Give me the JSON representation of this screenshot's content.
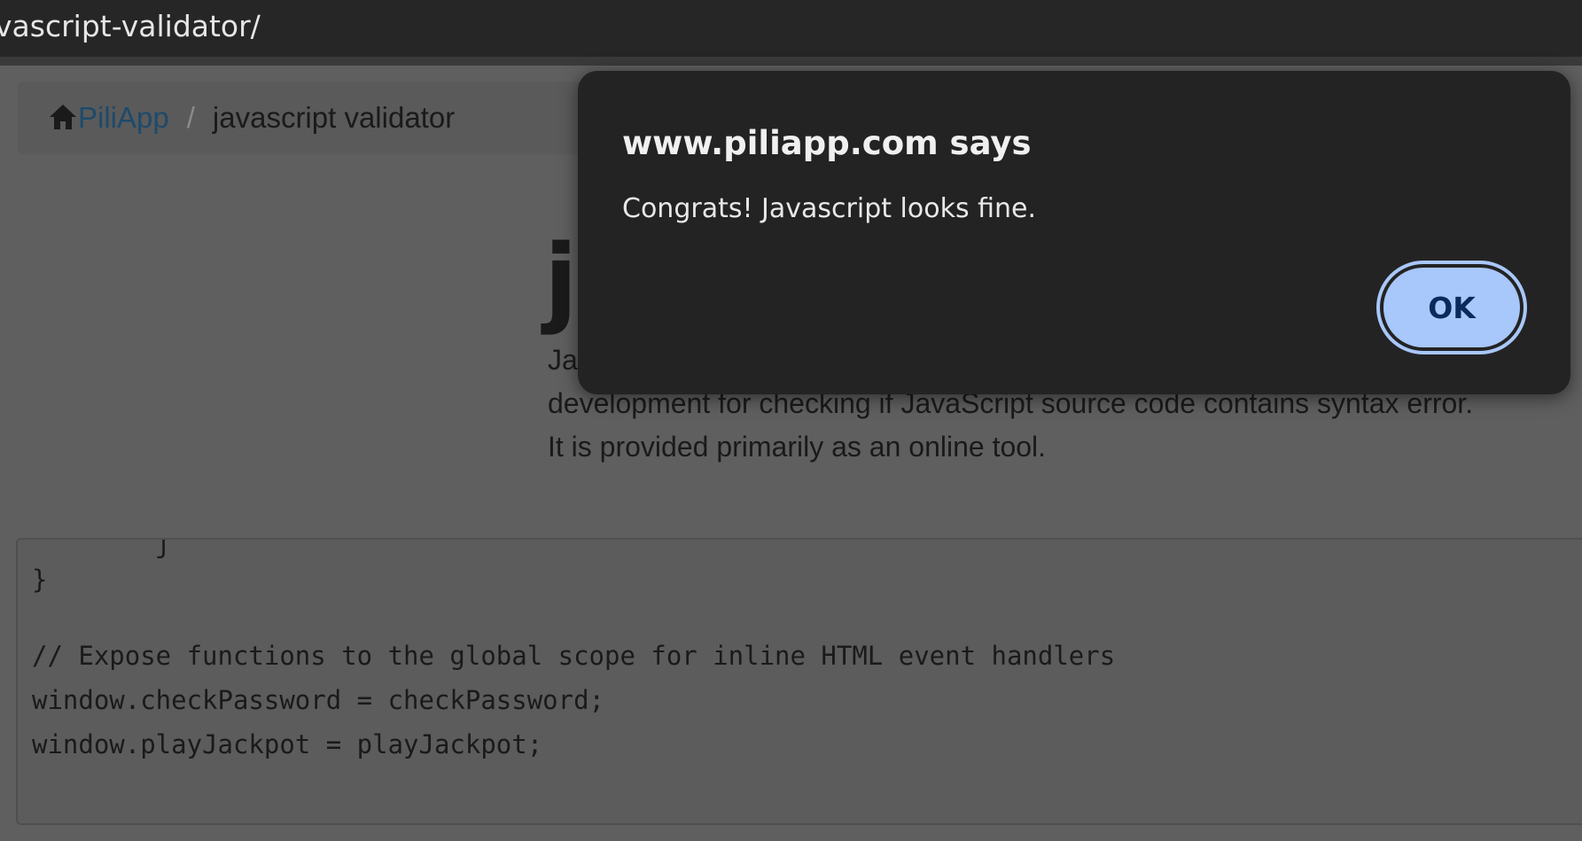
{
  "browser": {
    "url_fragment": "vascript-validator/"
  },
  "breadcrumb": {
    "home_label": "PiliApp",
    "separator": "/",
    "current": "javascript validator"
  },
  "page": {
    "title_partial": "ja",
    "description_lines": [
      "Ja",
      "development for checking if JavaScript source code contains syntax error.",
      "It is provided primarily as an online tool."
    ]
  },
  "code": {
    "lines": [
      "        ʃ",
      "}",
      "",
      "// Expose functions to the global scope for inline HTML event handlers",
      "window.checkPassword = checkPassword;",
      "window.playJackpot = playJackpot;"
    ]
  },
  "dialog": {
    "title": "www.piliapp.com says",
    "message": "Congrats! Javascript looks fine.",
    "ok_label": "OK"
  },
  "colors": {
    "ok_button_bg": "#a8c7fa",
    "ok_button_text": "#0b2a5c",
    "dialog_bg": "#232323",
    "link": "#1e4a6b"
  }
}
